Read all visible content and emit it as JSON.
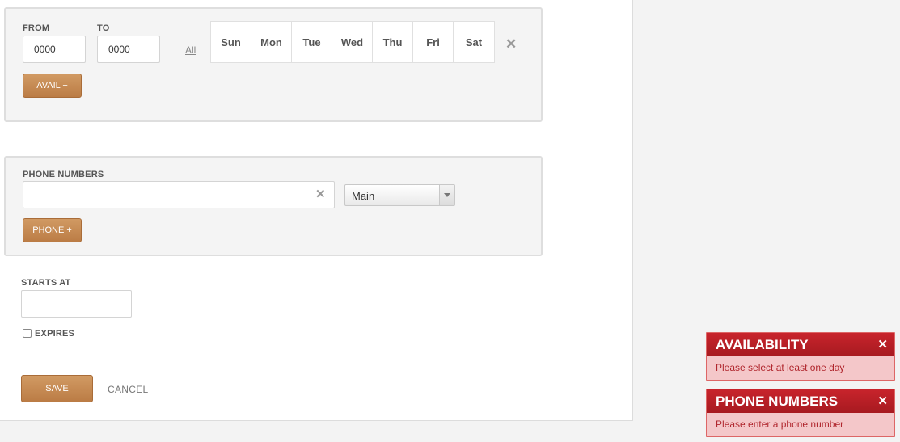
{
  "availability": {
    "from_label": "FROM",
    "to_label": "TO",
    "from_value": "0000",
    "to_value": "0000",
    "all_link": "All",
    "days": [
      "Sun",
      "Mon",
      "Tue",
      "Wed",
      "Thu",
      "Fri",
      "Sat"
    ],
    "remove_icon": "✕",
    "add_button": "AVAIL +"
  },
  "phone": {
    "label": "PHONE NUMBERS",
    "value": "",
    "clear_icon": "✕",
    "type_selected": "Main",
    "add_button": "PHONE +"
  },
  "starts_at": {
    "label": "STARTS AT",
    "value": ""
  },
  "expires": {
    "label": "EXPIRES",
    "checked": false
  },
  "actions": {
    "save": "SAVE",
    "cancel": "CANCEL"
  },
  "notifications": [
    {
      "title": "AVAILABILITY",
      "message": "Please select at least one day",
      "close": "✕"
    },
    {
      "title": "PHONE NUMBERS",
      "message": "Please enter a phone number",
      "close": "✕"
    }
  ],
  "colors": {
    "button_brown": "#c48952",
    "error_red": "#b81f26",
    "error_bg": "#f4c7c9"
  }
}
